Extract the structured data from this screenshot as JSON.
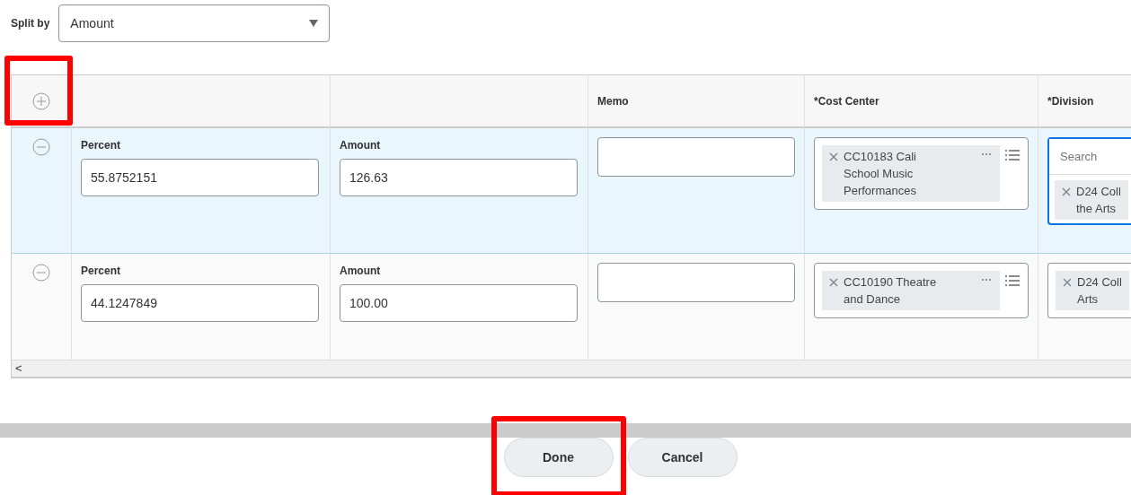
{
  "split_by": {
    "label": "Split by",
    "value": "Amount"
  },
  "table": {
    "add_button": {
      "highlighted": true
    },
    "columns": [
      {
        "label": "Memo"
      },
      {
        "label": "*Cost Center"
      },
      {
        "label": "*Division"
      }
    ],
    "rows": [
      {
        "selected": true,
        "percent": {
          "label": "Percent",
          "value": "55.8752151"
        },
        "amount": {
          "label": "Amount",
          "value": "126.63"
        },
        "cost_center": {
          "text": "CC10183 Cali School Music Performances"
        },
        "division": {
          "focused": true,
          "placeholder": "Search",
          "lines": [
            "D24 Coll",
            "the Arts"
          ]
        }
      },
      {
        "selected": false,
        "percent": {
          "label": "Percent",
          "value": "44.1247849"
        },
        "amount": {
          "label": "Amount",
          "value": "100.00"
        },
        "cost_center": {
          "text": "CC10190 Theatre and Dance"
        },
        "division": {
          "focused": false,
          "lines": [
            "D24 Coll",
            "Arts"
          ]
        }
      }
    ],
    "scroll_left": "<"
  },
  "buttons": [
    {
      "label": "Done",
      "highlighted": true
    },
    {
      "label": "Cancel",
      "highlighted": false
    }
  ]
}
